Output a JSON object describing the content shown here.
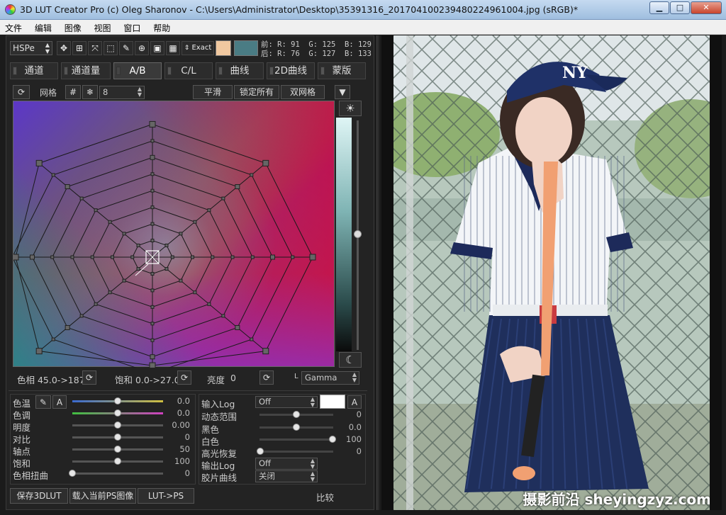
{
  "window": {
    "title": "3D LUT Creator Pro (c) Oleg Sharonov - C:\\Users\\Administrator\\Desktop\\35391316_20170410023948022496100​4.jpg (sRGB)*",
    "min_label": "▁",
    "max_label": "□",
    "close_label": "✕"
  },
  "menu": [
    "文件",
    "编辑",
    "图像",
    "视图",
    "窗口",
    "帮助"
  ],
  "toolbar": {
    "mode": "HSPe",
    "exact_label": "Exact",
    "swatch_before": "#f0c8a0",
    "swatch_after": "#4a7c84",
    "before_label": "前:",
    "after_label": "后:",
    "before_r": "R:  91",
    "before_g": "G: 125",
    "before_b": "B: 129",
    "after_r": "R:  76",
    "after_g": "G: 127",
    "after_b": "B: 133"
  },
  "tabs": [
    "通道",
    "通道量",
    "A/B",
    "C/L",
    "曲线",
    "2D曲线",
    "蒙版"
  ],
  "active_tab": "A/B",
  "grid_bar": {
    "grid_label": "网格",
    "grid_count": "8",
    "smooth_label": "平滑",
    "lock_all_label": "锁定所有",
    "dual_grid_label": "双网格"
  },
  "chart_status": {
    "hue": "色相 45.0->187",
    "saturation": "饱和 0.0->27.0",
    "brightness": "亮度",
    "brightness_val": "0",
    "l_label": "L",
    "gamma": "Gamma"
  },
  "adjust_left": {
    "rows": [
      {
        "label": "色温",
        "value": "0.0",
        "pos": 0.5
      },
      {
        "label": "色调",
        "value": "0.0",
        "pos": 0.5
      },
      {
        "label": "明度",
        "value": "0.00",
        "pos": 0.5
      },
      {
        "label": "对比",
        "value": "0",
        "pos": 0.5
      },
      {
        "label": "轴点",
        "value": "50",
        "pos": 0.5
      },
      {
        "label": "饱和",
        "value": "100",
        "pos": 0.5
      },
      {
        "label": "色相扭曲",
        "value": "0",
        "pos": 0.0
      }
    ],
    "a_label": "A"
  },
  "adjust_right": {
    "input_log_label": "输入Log",
    "input_log_value": "Off",
    "dyn_range_label": "动态范围",
    "dyn_range_value": "0",
    "black_label": "黑色",
    "black_value": "0.0",
    "white_label": "白色",
    "white_value": "100",
    "highlight_label": "高光恢复",
    "highlight_value": "0",
    "output_log_label": "输出Log",
    "output_log_value": "Off",
    "film_curve_label": "胶片曲线",
    "film_curve_value": "关闭",
    "a_label": "A"
  },
  "bottom": {
    "save_label": "保存3DLUT",
    "load_label": "载入当前PS图像",
    "lut_ps_label": "LUT->PS",
    "compare_label": "比较"
  },
  "watermark": "摄影前沿 sheyingzyz.com",
  "colors": {
    "panel_bg": "#232323",
    "accent_swatch_before": "#f0c8a0",
    "accent_swatch_after": "#4a7c84"
  }
}
